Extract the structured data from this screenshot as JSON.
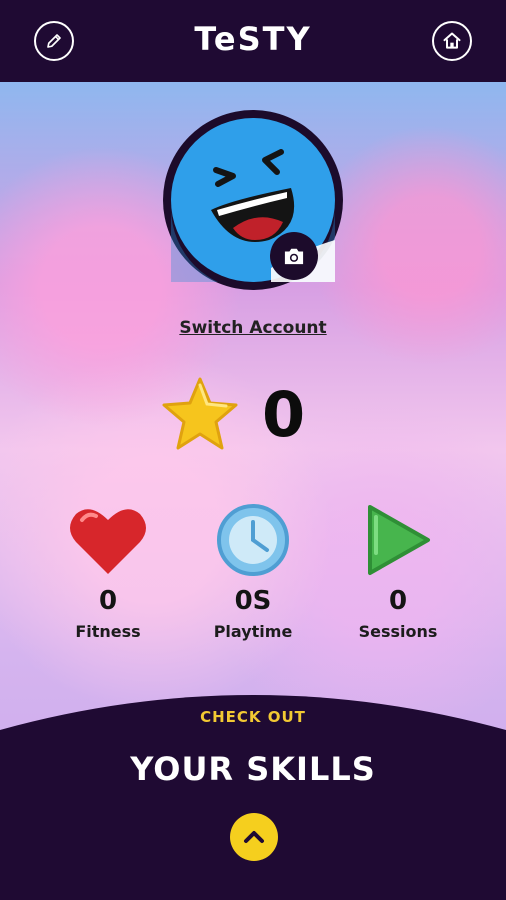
{
  "header": {
    "title": "TeSTY",
    "edit_icon": "pencil-icon",
    "home_icon": "home-icon"
  },
  "profile": {
    "switch_account_label": "Switch Account",
    "camera_icon": "camera-icon"
  },
  "score": {
    "value": "0",
    "icon": "star-icon"
  },
  "stats": [
    {
      "label": "Fitness",
      "value": "0",
      "icon": "heart-icon"
    },
    {
      "label": "Playtime",
      "value": "0S",
      "icon": "clock-icon"
    },
    {
      "label": "Sessions",
      "value": "0",
      "icon": "play-icon"
    }
  ],
  "bottom_panel": {
    "eyebrow": "CHECK OUT",
    "title": "YOUR SKILLS",
    "expand_icon": "chevron-up-icon"
  },
  "colors": {
    "dark_purple": "#1f0a33",
    "accent_yellow": "#f5cf1e",
    "text_yellow": "#f2c933"
  }
}
